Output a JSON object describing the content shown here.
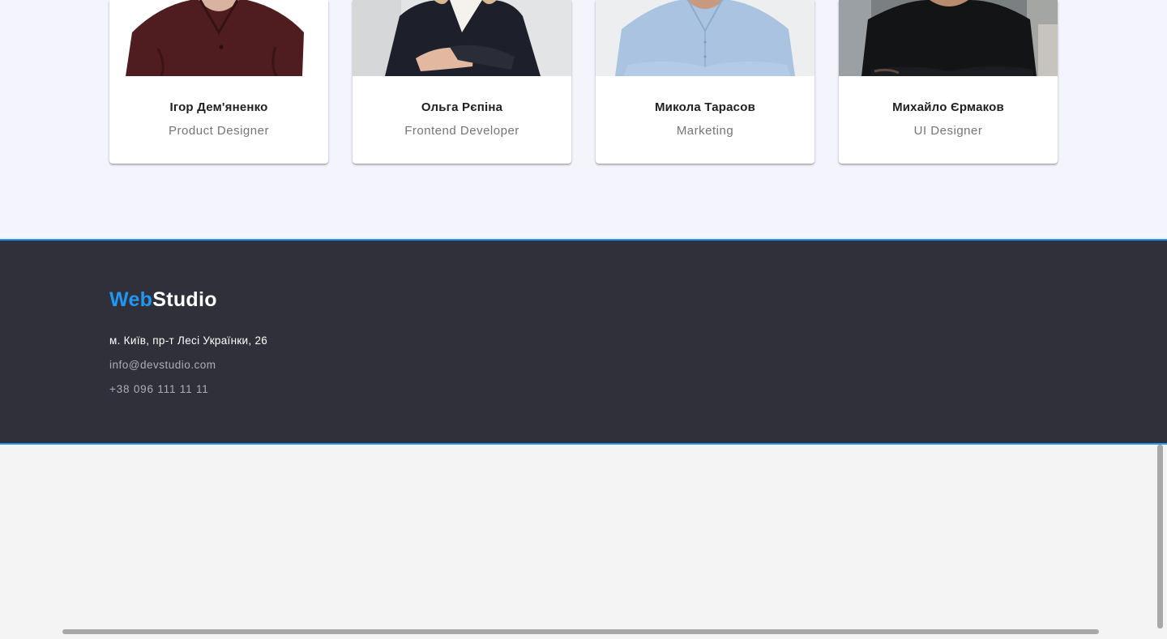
{
  "team": {
    "members": [
      {
        "name": "Ігор Дем'яненко",
        "role": "Product Designer",
        "photo": "photo-man-maroon-shirt"
      },
      {
        "name": "Ольга Рєпіна",
        "role": "Frontend Developer",
        "photo": "photo-woman-dark-blazer"
      },
      {
        "name": "Микола Тарасов",
        "role": "Marketing",
        "photo": "photo-man-light-blue-shirt"
      },
      {
        "name": "Михайло Єрмаков",
        "role": "UI Designer",
        "photo": "photo-man-black-tshirt"
      }
    ]
  },
  "footer": {
    "logo": {
      "part1": "Web",
      "part2": "Studio"
    },
    "address": "м. Київ, пр-т Лесі Українки, 26",
    "email": "info@devstudio.com",
    "phone": "+38 096 111 11 11"
  },
  "colors": {
    "accent": "#2196f3",
    "footer_bg": "#2f303a",
    "section_bg": "#f4f4fd"
  }
}
